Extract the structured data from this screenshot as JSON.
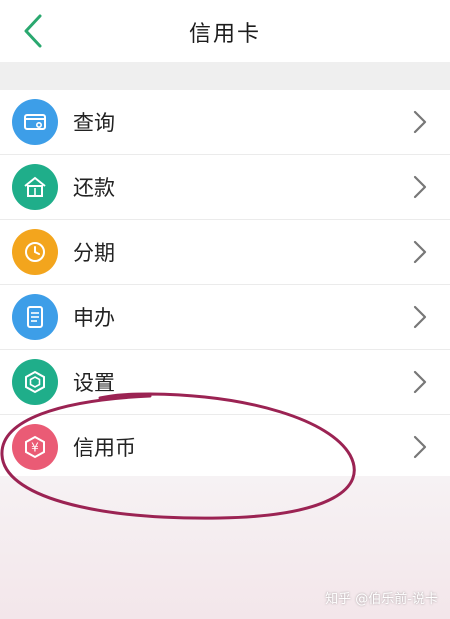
{
  "header": {
    "title": "信用卡"
  },
  "menu": [
    {
      "label": "查询",
      "color": "#3d9ee8",
      "icon": "card-search-icon"
    },
    {
      "label": "还款",
      "color": "#1fae8a",
      "icon": "home-icon"
    },
    {
      "label": "分期",
      "color": "#f3a51d",
      "icon": "clock-icon"
    },
    {
      "label": "申办",
      "color": "#3d9ee8",
      "icon": "document-icon"
    },
    {
      "label": "设置",
      "color": "#1fae8a",
      "icon": "hexagon-icon"
    },
    {
      "label": "信用币",
      "color": "#ea5b75",
      "icon": "coin-icon"
    }
  ],
  "watermark": "知乎 @伯乐前-说卡",
  "colors": {
    "accent": "#2aa86f",
    "annotation": "#9b2353"
  }
}
